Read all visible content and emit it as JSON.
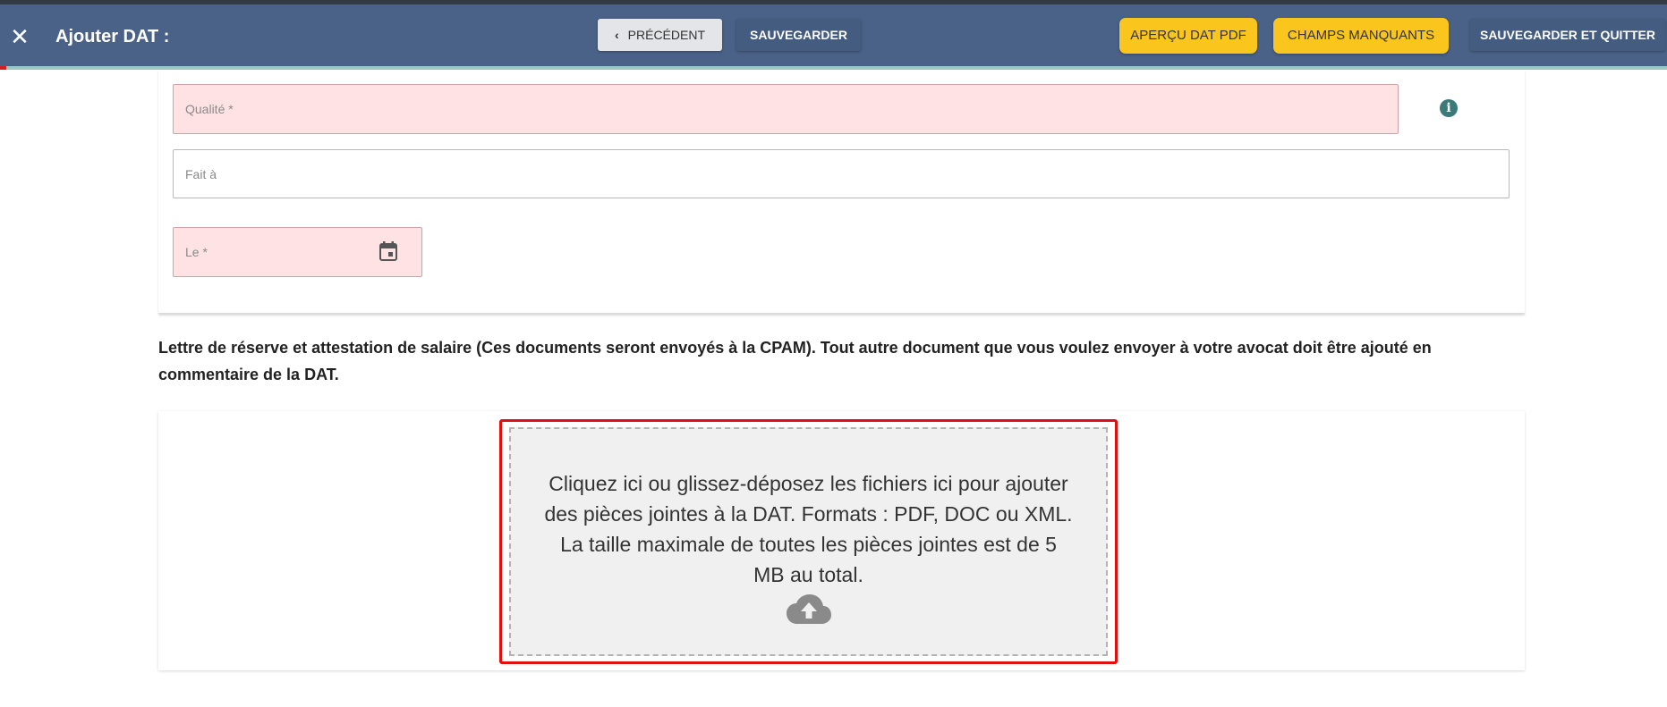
{
  "toolbar": {
    "close_icon": "close-icon",
    "title": "Ajouter DAT :",
    "prev_label": "PRÉCÉDENT",
    "save_label": "SAUVEGARDER",
    "preview_label": "APERÇU DAT PDF",
    "missing_label": "CHAMPS MANQUANTS",
    "save_quit_label": "SAUVEGARDER ET QUITTER",
    "colors": {
      "bar": "#4a6288",
      "accent_yellow": "#fac51c",
      "error_fill": "#ffe3e4"
    }
  },
  "form": {
    "qualite_label": "Qualité *",
    "fait_a_label": "Fait à",
    "le_label": "Le *"
  },
  "attachments": {
    "heading": "Lettre de réserve et attestation de salaire (Ces documents seront envoyés à la CPAM). Tout autre document que vous voulez envoyer à votre avocat doit être ajouté en commentaire de la DAT.",
    "drop_text_1": "Cliquez ici ou glissez-déposez les fichiers ici pour ajouter",
    "drop_text_2": "des pièces jointes à la DAT. Formats : PDF, DOC ou XML.",
    "drop_text_3": "La taille maximale de toutes les pièces jointes est de 5",
    "drop_text_4": "MB au total.",
    "icon": "cloud-upload-icon"
  }
}
